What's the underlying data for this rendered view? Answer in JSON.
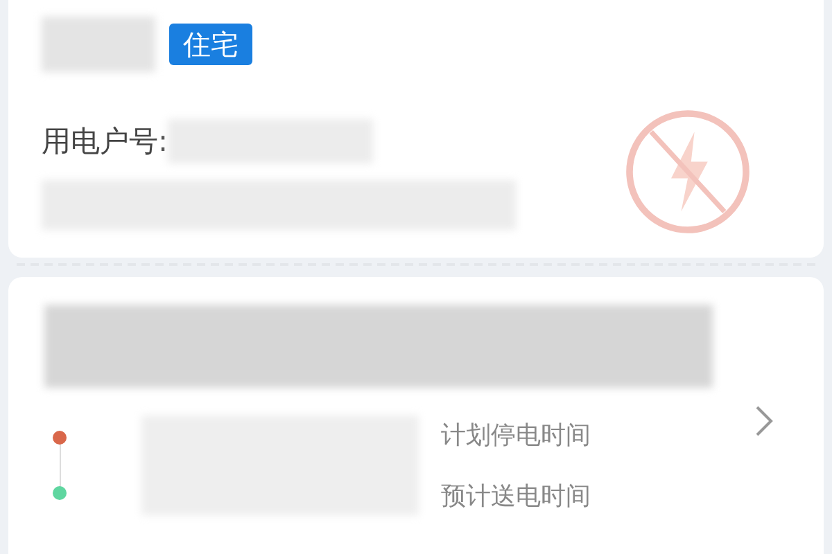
{
  "account": {
    "tag": "住宅",
    "number_label": "用电户号:"
  },
  "outage": {
    "times": [
      {
        "label": "计划停电时间",
        "color": "#d9674a"
      },
      {
        "label": "预计送电时间",
        "color": "#5fd6a0"
      }
    ]
  }
}
